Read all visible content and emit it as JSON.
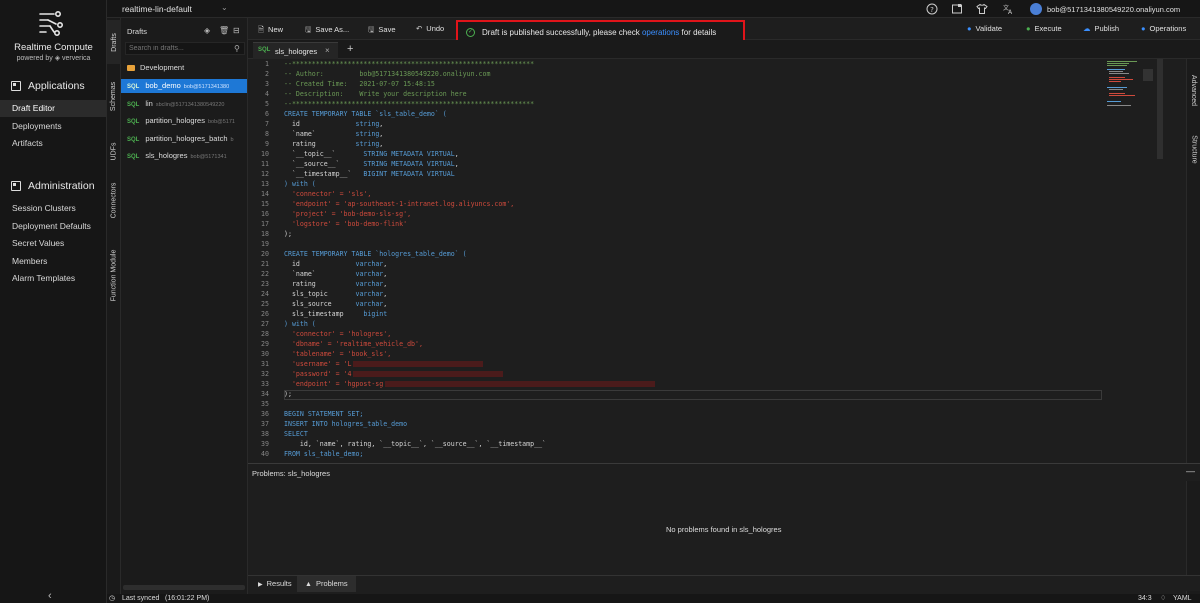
{
  "sidebar": {
    "brand": "Realtime Compute",
    "powered": "powered by ◈ ververica",
    "applications": {
      "title": "Applications",
      "items": [
        "Draft Editor",
        "Deployments",
        "Artifacts"
      ]
    },
    "administration": {
      "title": "Administration",
      "items": [
        "Session Clusters",
        "Deployment Defaults",
        "Secret Values",
        "Members",
        "Alarm Templates"
      ]
    }
  },
  "vtabs": [
    "Drafts",
    "Schemas",
    "UDFs",
    "Connectors",
    "Function Module"
  ],
  "topbar": {
    "workspace": "realtime-lin-default",
    "account": "bob@5171341380549220.onaliyun.com"
  },
  "drafts": {
    "header": "Drafts",
    "search_placeholder": "Search in drafts...",
    "folder": "Development",
    "items": [
      {
        "name": "bob_demo",
        "owner": "bob@5171341380",
        "badge": "SQL"
      },
      {
        "name": "lin",
        "owner": "sbclin@5171341380549220",
        "badge": "SQL"
      },
      {
        "name": "partition_hologres",
        "owner": "bob@5171",
        "badge": "SQL"
      },
      {
        "name": "partition_hologres_batch",
        "owner": "b",
        "badge": "SQL"
      },
      {
        "name": "sls_hologres",
        "owner": "bob@5171341",
        "badge": "SQL"
      }
    ]
  },
  "toolbar": {
    "new": "New",
    "save_as": "Save As...",
    "save": "Save",
    "undo": "Undo",
    "validate": "Validate",
    "execute": "Execute",
    "publish": "Publish",
    "operations": "Operations"
  },
  "notification": {
    "prefix": "Draft is published successfully, please check",
    "link": "operations",
    "suffix": "for details"
  },
  "tab": {
    "name": "sls_hologres",
    "badge": "SQL"
  },
  "code": [
    "--*************************************************************",
    "-- Author:         bob@5171341380549220.onaliyun.com",
    "-- Created Time:   2021-07-07 15:48:15",
    "-- Description:    Write your description here",
    "--*************************************************************",
    "CREATE TEMPORARY TABLE `sls_table_demo` (",
    "  id              string,",
    "  `name`          string,",
    "  rating          string,",
    "  `__topic__`       STRING METADATA VIRTUAL,",
    "  `__source__`      STRING METADATA VIRTUAL,",
    "  `__timestamp__`   BIGINT METADATA VIRTUAL",
    ") with (",
    "  'connector' = 'sls',",
    "  'endpoint' = 'ap-southeast-1-intranet.log.aliyuncs.com',",
    "  'project' = 'bob-demo-sls-sg',",
    "  'logstore' = 'bob-demo-flink'",
    ");",
    "",
    "CREATE TEMPORARY TABLE `hologres_table_demo` (",
    "  id              varchar,",
    "  `name`          varchar,",
    "  rating          varchar,",
    "  sls_topic       varchar,",
    "  sls_source      varchar,",
    "  sls_timestamp     bigint",
    ") with (",
    "  'connector' = 'hologres',",
    "  'dbname' = 'realtime_vehicle_db',",
    "  'tablename' = 'book_sls',",
    "  'username' = 'L",
    "  'password' = '4",
    "  'endpoint' = 'hgpost-sg",
    ");",
    "",
    "BEGIN STATEMENT SET;",
    "INSERT INTO hologres_table_demo",
    "SELECT",
    "    id, `name`, rating, `__topic__`, `__source__`, `__timestamp__`",
    "FROM sls_table_demo;"
  ],
  "problems": {
    "title": "Problems: sls_hologres",
    "empty": "No problems found in sls_hologres",
    "tabs": [
      "Results",
      "Problems"
    ]
  },
  "right_rail": [
    "Advanced",
    "Structure"
  ],
  "status": {
    "synced": "Last synced",
    "time": "(16:01:22 PM)",
    "cursor": "34:3",
    "lang": "YAML"
  }
}
